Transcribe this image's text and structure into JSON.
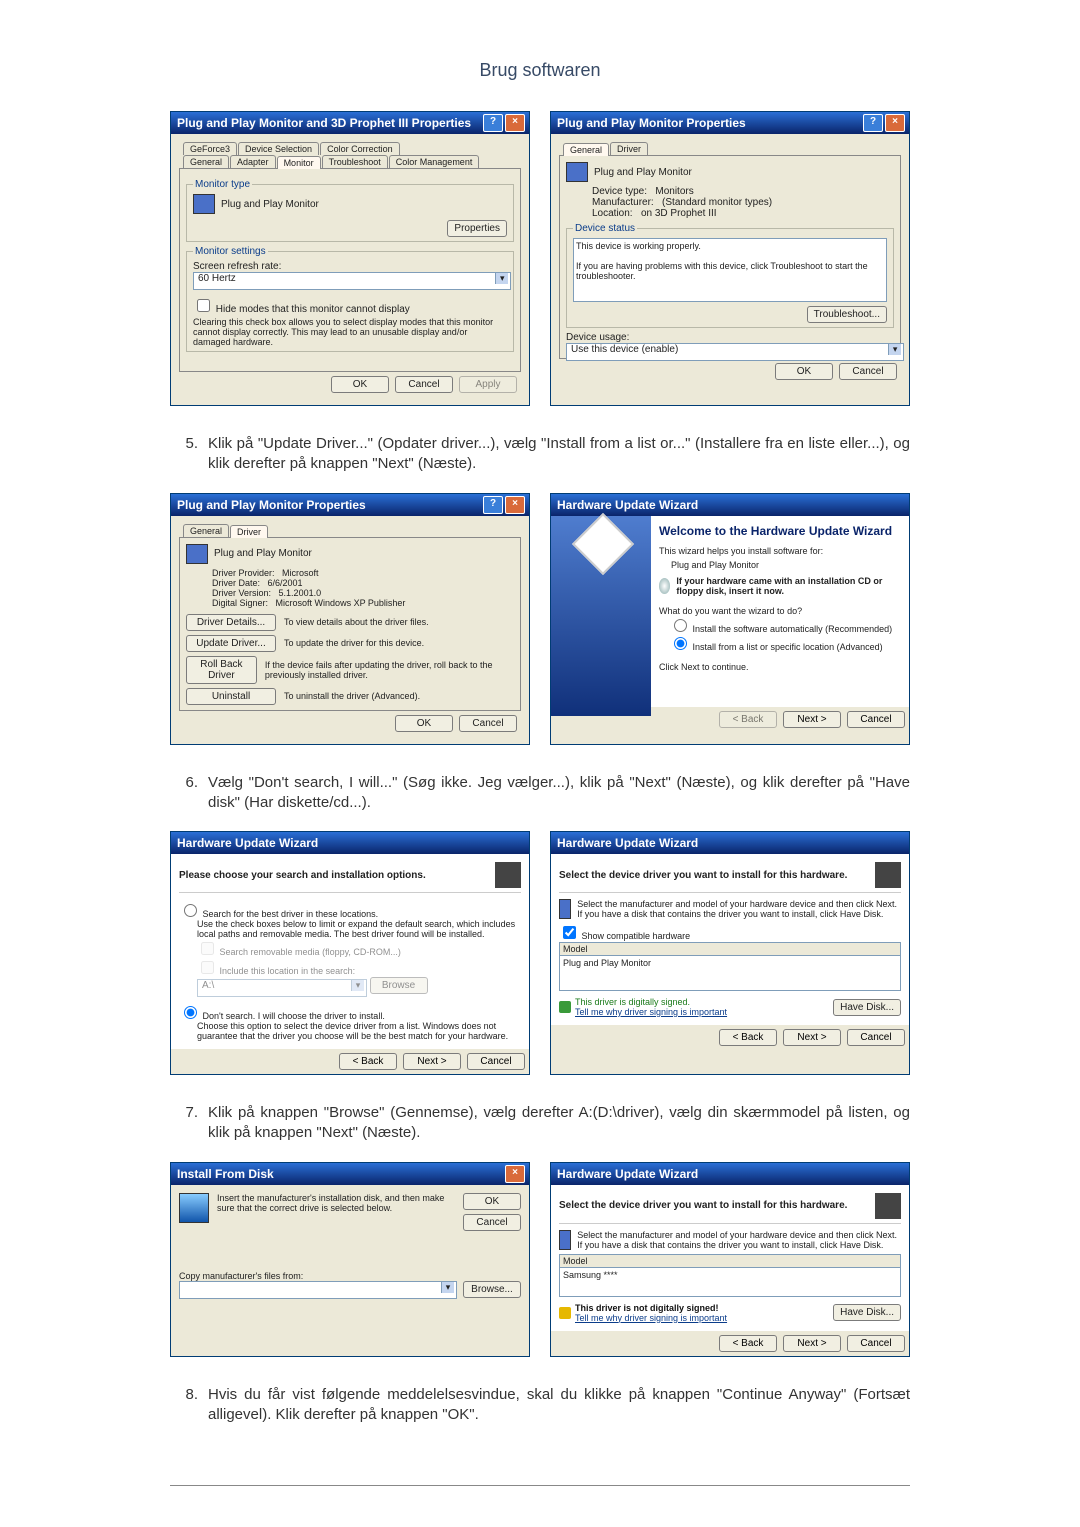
{
  "page_title": "Brug softwaren",
  "props1": {
    "title": "Plug and Play Monitor and 3D Prophet III Properties",
    "tabs_row1": [
      "GeForce3",
      "Device Selection",
      "Color Correction"
    ],
    "tabs_row2": [
      "General",
      "Adapter",
      "Monitor",
      "Troubleshoot",
      "Color Management"
    ],
    "mtype_label": "Monitor type",
    "mtype_value": "Plug and Play Monitor",
    "properties_btn": "Properties",
    "settings_label": "Monitor settings",
    "refresh_label": "Screen refresh rate:",
    "refresh_value": "60 Hertz",
    "hide_label": "Hide modes that this monitor cannot display",
    "hide_desc": "Clearing this check box allows you to select display modes that this monitor cannot display correctly. This may lead to an unusable display and/or damaged hardware.",
    "ok": "OK",
    "cancel": "Cancel",
    "apply": "Apply"
  },
  "props2": {
    "title": "Plug and Play Monitor Properties",
    "tabs": [
      "General",
      "Driver"
    ],
    "name": "Plug and Play Monitor",
    "devtype_lbl": "Device type:",
    "devtype_val": "Monitors",
    "mfr_lbl": "Manufacturer:",
    "mfr_val": "(Standard monitor types)",
    "loc_lbl": "Location:",
    "loc_val": "on 3D Prophet III",
    "status_heading": "Device status",
    "status_line1": "This device is working properly.",
    "status_line2": "If you are having problems with this device, click Troubleshoot to start the troubleshooter.",
    "troubleshoot": "Troubleshoot...",
    "usage_lbl": "Device usage:",
    "usage_val": "Use this device (enable)",
    "ok": "OK",
    "cancel": "Cancel"
  },
  "step5": "Klik på \"Update Driver...\" (Opdater driver...), vælg \"Install from a list or...\" (Installere fra en liste eller...), og klik derefter på knappen \"Next\" (Næste).",
  "drv": {
    "title": "Plug and Play Monitor Properties",
    "tabs": [
      "General",
      "Driver"
    ],
    "name": "Plug and Play Monitor",
    "prov_lbl": "Driver Provider:",
    "prov_val": "Microsoft",
    "date_lbl": "Driver Date:",
    "date_val": "6/6/2001",
    "ver_lbl": "Driver Version:",
    "ver_val": "5.1.2001.0",
    "sign_lbl": "Digital Signer:",
    "sign_val": "Microsoft Windows XP Publisher",
    "details_btn": "Driver Details...",
    "details_desc": "To view details about the driver files.",
    "update_btn": "Update Driver...",
    "update_desc": "To update the driver for this device.",
    "rollback_btn": "Roll Back Driver",
    "rollback_desc": "If the device fails after updating the driver, roll back to the previously installed driver.",
    "uninstall_btn": "Uninstall",
    "uninstall_desc": "To uninstall the driver (Advanced).",
    "ok": "OK",
    "cancel": "Cancel"
  },
  "wiz1": {
    "title": "Hardware Update Wizard",
    "heading": "Welcome to the Hardware Update Wizard",
    "intro": "This wizard helps you install software for:",
    "device": "Plug and Play Monitor",
    "cd_hint": "If your hardware came with an installation CD or floppy disk, insert it now.",
    "question": "What do you want the wizard to do?",
    "opt1": "Install the software automatically (Recommended)",
    "opt2": "Install from a list or specific location (Advanced)",
    "continue": "Click Next to continue.",
    "back": "< Back",
    "next": "Next >",
    "cancel": "Cancel"
  },
  "step6": "Vælg \"Don't search, I will...\" (Søg ikke. Jeg vælger...), klik på \"Next\" (Næste), og klik derefter på \"Have disk\" (Har diskette/cd...).",
  "wiz2": {
    "title": "Hardware Update Wizard",
    "heading": "Please choose your search and installation options.",
    "opt_search": "Search for the best driver in these locations.",
    "search_desc": "Use the check boxes below to limit or expand the default search, which includes local paths and removable media. The best driver found will be installed.",
    "chk_removable": "Search removable media (floppy, CD-ROM...)",
    "chk_include": "Include this location in the search:",
    "path": "A:\\",
    "browse": "Browse",
    "opt_dont": "Don't search. I will choose the driver to install.",
    "dont_desc": "Choose this option to select the device driver from a list. Windows does not guarantee that the driver you choose will be the best match for your hardware.",
    "back": "< Back",
    "next": "Next >",
    "cancel": "Cancel"
  },
  "wiz3": {
    "title": "Hardware Update Wizard",
    "heading": "Select the device driver you want to install for this hardware.",
    "desc": "Select the manufacturer and model of your hardware device and then click Next. If you have a disk that contains the driver you want to install, click Have Disk.",
    "compat": "Show compatible hardware",
    "model_lbl": "Model",
    "model_val": "Plug and Play Monitor",
    "signed": "This driver is digitally signed.",
    "tell": "Tell me why driver signing is important",
    "have_disk": "Have Disk...",
    "back": "< Back",
    "next": "Next >",
    "cancel": "Cancel"
  },
  "step7": "Klik på knappen \"Browse\" (Gennemse), vælg derefter A:(D:\\driver), vælg din skærmmodel på listen, og klik på knappen \"Next\" (Næste).",
  "install": {
    "title": "Install From Disk",
    "desc": "Insert the manufacturer's installation disk, and then make sure that the correct drive is selected below.",
    "ok": "OK",
    "cancel": "Cancel",
    "copy_lbl": "Copy manufacturer's files from:",
    "path": "",
    "browse": "Browse..."
  },
  "wiz4": {
    "title": "Hardware Update Wizard",
    "heading": "Select the device driver you want to install for this hardware.",
    "desc": "Select the manufacturer and model of your hardware device and then click Next. If you have a disk that contains the driver you want to install, click Have Disk.",
    "model_lbl": "Model",
    "model_val": "Samsung ****",
    "unsign": "This driver is not digitally signed!",
    "tell": "Tell me why driver signing is important",
    "have_disk": "Have Disk...",
    "back": "< Back",
    "next": "Next >",
    "cancel": "Cancel"
  },
  "step8": "Hvis du får vist følgende meddelelsesvindue, skal du klikke på knappen \"Continue Anyway\" (Fortsæt alligevel). Klik derefter på knappen \"OK\"."
}
